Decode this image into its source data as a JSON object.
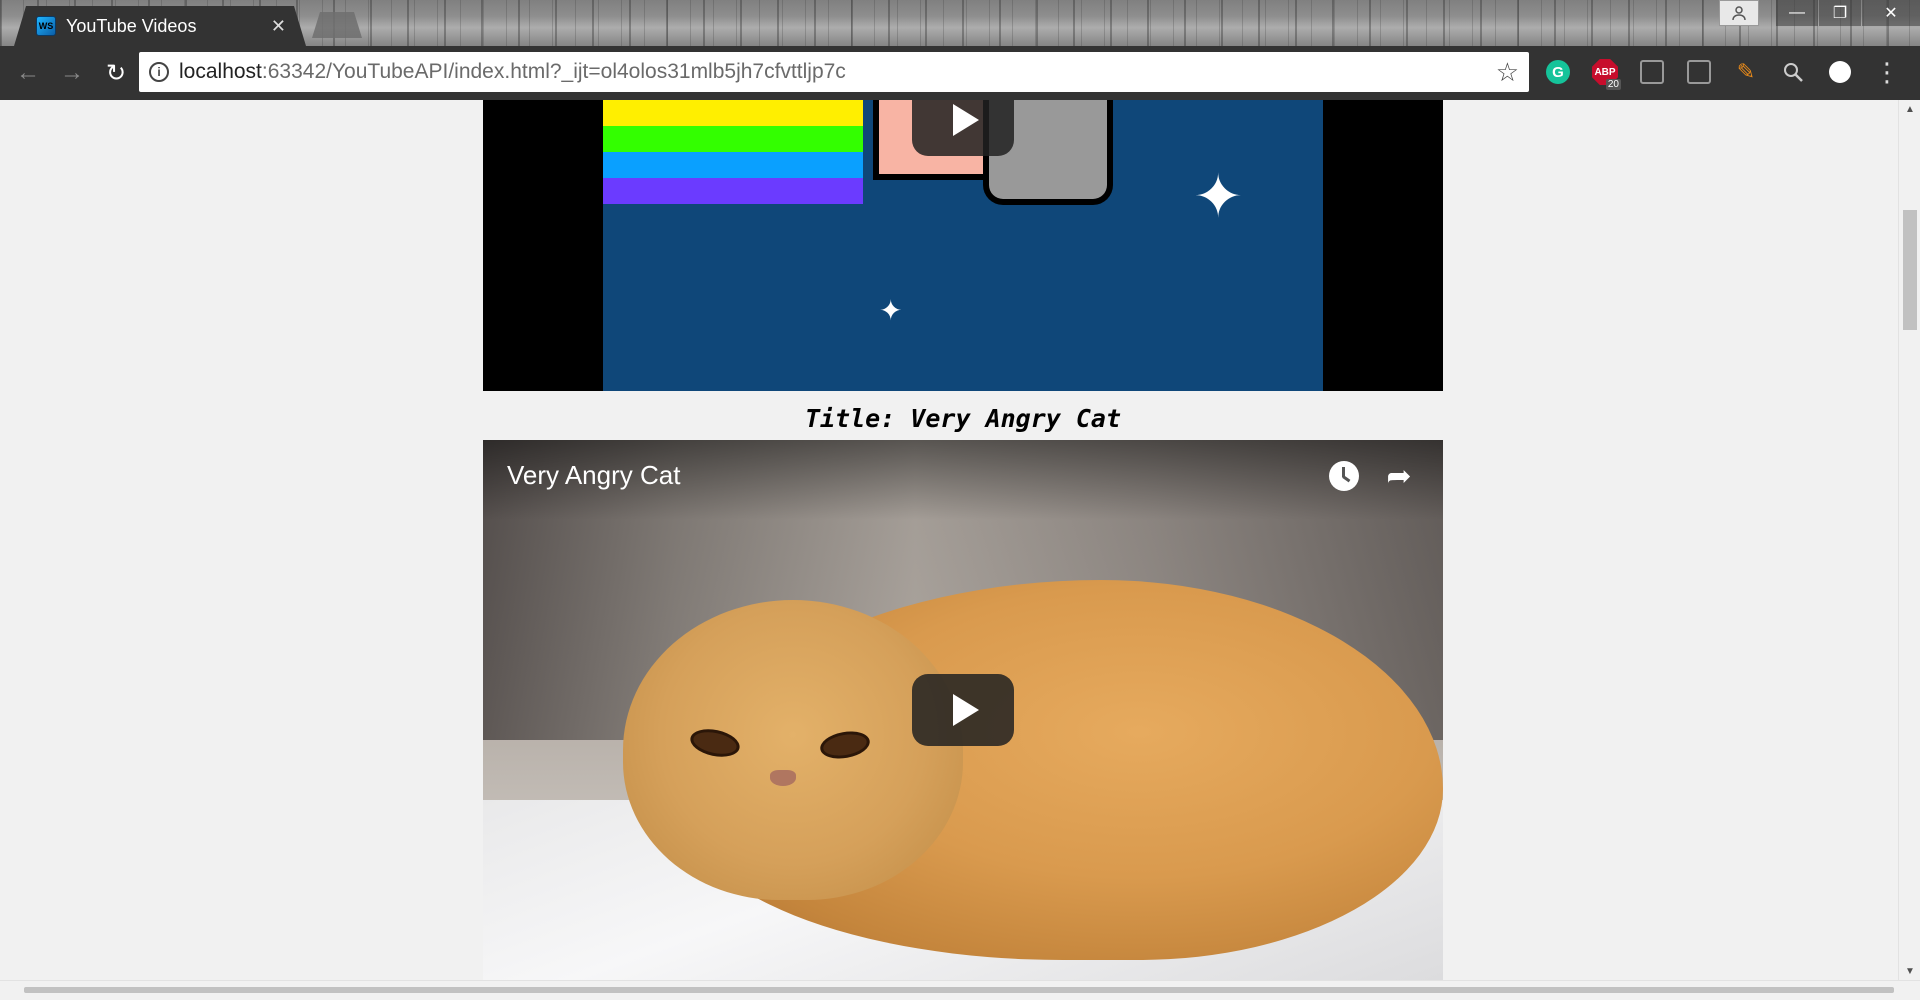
{
  "browser": {
    "tab": {
      "title": "YouTube Videos",
      "favicon_text": "WS",
      "close_glyph": "✕"
    },
    "window_controls": {
      "user": "person-icon",
      "minimize": "—",
      "restore": "❐",
      "close": "✕"
    },
    "nav": {
      "back": "←",
      "forward": "→",
      "reload": "↻"
    },
    "address": {
      "host": "localhost",
      "path": ":63342/YouTubeAPI/index.html?_ijt=ol4olos31mlb5jh7cfvttljp7c",
      "info_glyph": "i",
      "star_glyph": "☆"
    },
    "extensions": {
      "grammarly": "G",
      "abp": "ABP",
      "abp_count": "20",
      "menu": "⋮"
    }
  },
  "page": {
    "video1": {
      "name": "Nyan Cat video (partially scrolled)",
      "sparkle_glyph": "✦"
    },
    "video2_caption": "Title: Very Angry Cat",
    "video2": {
      "title": "Very Angry Cat",
      "share_glyph": "➦"
    }
  },
  "scrollbar": {
    "up": "▲",
    "down": "▼"
  }
}
